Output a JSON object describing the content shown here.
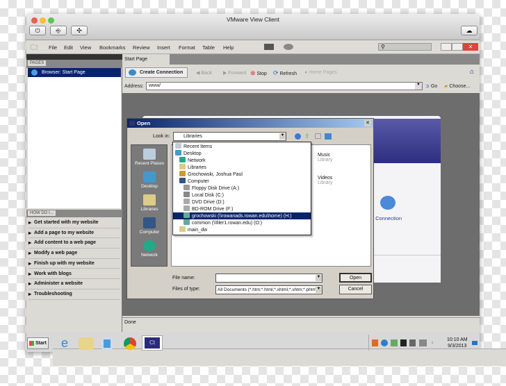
{
  "window": {
    "title": "VMware View Client"
  },
  "menu": [
    "File",
    "Edit",
    "View",
    "Bookmarks",
    "Review",
    "Insert",
    "Format",
    "Table",
    "Help"
  ],
  "app_logo": "Ct",
  "search": {
    "placeholder": ""
  },
  "left": {
    "pages_label": "PAGES",
    "pages_item": "Browser: Start Page",
    "howdoi_label": "HOW DO I...",
    "howdoi": [
      "Get started with my website",
      "Add a page to my website",
      "Add content to a web page",
      "Modify a web page",
      "Finish up with my website",
      "Work with blogs",
      "Administer a website",
      "Troubleshooting"
    ]
  },
  "tab": "Start Page",
  "toolbar": {
    "create": "Create Connection",
    "back": "Back",
    "forward": "Forward",
    "stop": "Stop",
    "refresh": "Refresh",
    "home_pages": "Home Pages"
  },
  "address": {
    "label": "Address:",
    "value": "www/",
    "go": "Go",
    "choose": "Choose..."
  },
  "page": {
    "blog_connection": "Blog Connection"
  },
  "dialog": {
    "title": "Open",
    "look_in_label": "Look in:",
    "look_in_value": "Libraries",
    "places": [
      "Recent Places",
      "Desktop",
      "Libraries",
      "Computer",
      "Network"
    ],
    "list": [
      {
        "label": "Recent Items",
        "indent": 0
      },
      {
        "label": "Desktop",
        "indent": 0
      },
      {
        "label": "Network",
        "indent": 1
      },
      {
        "label": "Libraries",
        "indent": 1
      },
      {
        "label": "Grochowski, Joshua Paul",
        "indent": 1
      },
      {
        "label": "Computer",
        "indent": 1
      },
      {
        "label": "Floppy Disk Drive (A:)",
        "indent": 2
      },
      {
        "label": "Local Disk (C:)",
        "indent": 2
      },
      {
        "label": "DVD Drive (D:)",
        "indent": 2
      },
      {
        "label": "BD-ROM Drive (F:)",
        "indent": 2
      },
      {
        "label": "grochowski (\\\\rowanads.rowan.edu\\home) (H:)",
        "indent": 2,
        "selected": true
      },
      {
        "label": "common (\\\\filer1.rowan.edu) (O:)",
        "indent": 2
      },
      {
        "label": "main_dw",
        "indent": 1
      }
    ],
    "libraries": [
      {
        "name": "Music",
        "sub": "Library"
      },
      {
        "name": "Videos",
        "sub": "Library"
      }
    ],
    "file_name_label": "File name:",
    "file_name_value": "",
    "files_of_type_label": "Files of type:",
    "files_of_type_value": "All Documents (*.htm;*.html;*.xhtml;*.shtm;*.phtml)",
    "open": "Open",
    "cancel": "Cancel"
  },
  "status": "Done",
  "taskbar": {
    "start": "Start",
    "time": "10:10 AM",
    "date": "9/3/2013",
    "active_app": "Ct"
  }
}
